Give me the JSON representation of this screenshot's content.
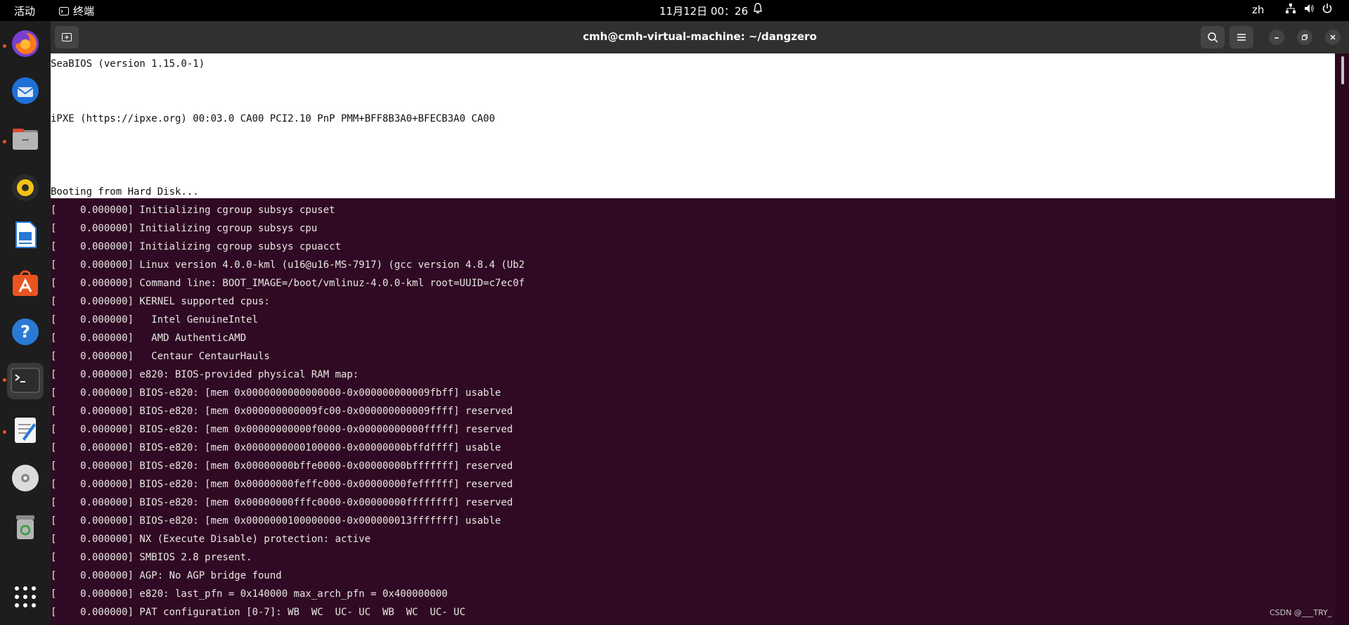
{
  "topbar": {
    "activities": "活动",
    "app_name": "终端",
    "datetime": "11月12日  00：26",
    "language": "zh"
  },
  "dock": {
    "items": [
      {
        "name": "firefox",
        "running": true
      },
      {
        "name": "thunderbird",
        "running": false
      },
      {
        "name": "files",
        "running": true
      },
      {
        "name": "rhythmbox",
        "running": false
      },
      {
        "name": "libreoffice-writer",
        "running": false
      },
      {
        "name": "app-center",
        "running": false
      },
      {
        "name": "help",
        "running": false
      },
      {
        "name": "terminal",
        "running": true,
        "active": true
      },
      {
        "name": "text-editor",
        "running": true
      },
      {
        "name": "disc",
        "running": false
      },
      {
        "name": "trash",
        "running": false
      },
      {
        "name": "show-apps",
        "running": false
      }
    ]
  },
  "window": {
    "title": "cmh@cmh-virtual-machine: ~/dangzero"
  },
  "bios": {
    "lines": [
      "SeaBIOS (version 1.15.0-1)",
      "iPXE (https://ipxe.org) 00:03.0 CA00 PCI2.10 PnP PMM+BFF8B3A0+BFECB3A0 CA00",
      "Booting from Hard Disk..."
    ]
  },
  "log": {
    "lines": [
      "[    0.000000] Initializing cgroup subsys cpuset",
      "[    0.000000] Initializing cgroup subsys cpu",
      "[    0.000000] Initializing cgroup subsys cpuacct",
      "[    0.000000] Linux version 4.0.0-kml (u16@u16-MS-7917) (gcc version 4.8.4 (Ub2",
      "[    0.000000] Command line: BOOT_IMAGE=/boot/vmlinuz-4.0.0-kml root=UUID=c7ec0f",
      "[    0.000000] KERNEL supported cpus:",
      "[    0.000000]   Intel GenuineIntel",
      "[    0.000000]   AMD AuthenticAMD",
      "[    0.000000]   Centaur CentaurHauls",
      "[    0.000000] e820: BIOS-provided physical RAM map:",
      "[    0.000000] BIOS-e820: [mem 0x0000000000000000-0x000000000009fbff] usable",
      "[    0.000000] BIOS-e820: [mem 0x000000000009fc00-0x000000000009ffff] reserved",
      "[    0.000000] BIOS-e820: [mem 0x00000000000f0000-0x00000000000fffff] reserved",
      "[    0.000000] BIOS-e820: [mem 0x0000000000100000-0x00000000bffdffff] usable",
      "[    0.000000] BIOS-e820: [mem 0x00000000bffe0000-0x00000000bfffffff] reserved",
      "[    0.000000] BIOS-e820: [mem 0x00000000feffc000-0x00000000feffffff] reserved",
      "[    0.000000] BIOS-e820: [mem 0x00000000fffc0000-0x00000000ffffffff] reserved",
      "[    0.000000] BIOS-e820: [mem 0x0000000100000000-0x000000013fffffff] usable",
      "[    0.000000] NX (Execute Disable) protection: active",
      "[    0.000000] SMBIOS 2.8 present.",
      "[    0.000000] AGP: No AGP bridge found",
      "[    0.000000] e820: last_pfn = 0x140000 max_arch_pfn = 0x400000000",
      "[    0.000000] PAT configuration [0-7]: WB  WC  UC- UC  WB  WC  UC- UC"
    ]
  },
  "watermark": "CSDN @___TRY_"
}
